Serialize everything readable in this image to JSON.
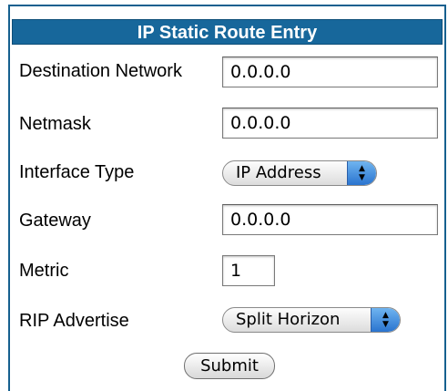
{
  "form": {
    "title": "IP Static Route Entry",
    "fields": {
      "destination_network": {
        "label": "Destination Network",
        "value": "0.0.0.0"
      },
      "netmask": {
        "label": "Netmask",
        "value": "0.0.0.0"
      },
      "interface_type": {
        "label": "Interface Type",
        "selected": "IP Address"
      },
      "gateway": {
        "label": "Gateway",
        "value": "0.0.0.0"
      },
      "metric": {
        "label": "Metric",
        "value": "1"
      },
      "rip_advertise": {
        "label": "RIP Advertise",
        "selected": "Split Horizon"
      }
    },
    "submit_label": "Submit"
  },
  "colors": {
    "header_bg": "#17679b",
    "header_text": "#ffffff",
    "frame_border": "#16608f"
  },
  "icons": {
    "select_arrows": "up-down-arrows-icon"
  }
}
